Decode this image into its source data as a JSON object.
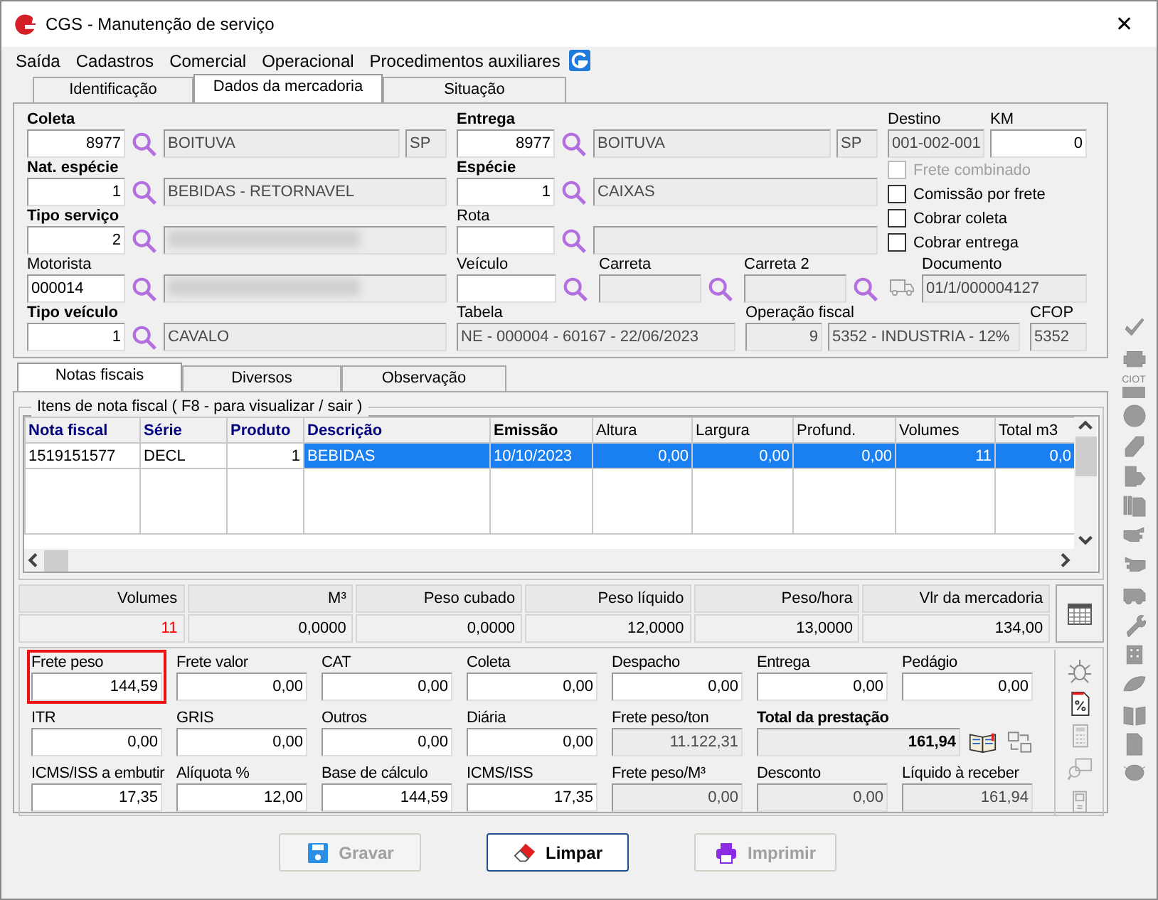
{
  "window": {
    "title": "CGS - Manutenção de serviço",
    "close": "✕"
  },
  "menu": [
    "Saída",
    "Cadastros",
    "Comercial",
    "Operacional",
    "Procedimentos auxiliares"
  ],
  "tabs": [
    {
      "label": "Identificação",
      "selected": false
    },
    {
      "label": "Dados da mercadoria",
      "selected": true
    },
    {
      "label": "Situação",
      "selected": false
    }
  ],
  "form": {
    "lines": [
      {
        "groups": [
          {
            "label": "Coleta",
            "bold": true,
            "lookup": true,
            "fields": [
              {
                "kind": "code",
                "value": "8977",
                "disabled": false
              },
              {
                "kind": "text",
                "value": "BOITUVA",
                "disabled": true
              },
              {
                "kind": "uf",
                "value": "SP",
                "disabled": true
              }
            ]
          },
          {
            "label": "Entrega",
            "bold": true,
            "lookup": true,
            "fields": [
              {
                "kind": "code",
                "value": "8977",
                "disabled": false
              },
              {
                "kind": "text",
                "value": "BOITUVA",
                "disabled": true
              },
              {
                "kind": "uf",
                "value": "SP",
                "disabled": true
              }
            ]
          }
        ]
      },
      {
        "groups": [
          {
            "label": "Nat. espécie",
            "bold": true,
            "lookup": true,
            "fields": [
              {
                "kind": "code",
                "value": "1",
                "disabled": false
              },
              {
                "kind": "text",
                "value": "BEBIDAS - RETORNAVEL",
                "disabled": true
              }
            ]
          },
          {
            "label": "Espécie",
            "bold": true,
            "lookup": true,
            "fields": [
              {
                "kind": "code",
                "value": "1",
                "disabled": false
              },
              {
                "kind": "text",
                "value": "CAIXAS",
                "disabled": true
              }
            ]
          }
        ]
      },
      {
        "groups": [
          {
            "label": "Tipo serviço",
            "bold": true,
            "lookup": true,
            "fields": [
              {
                "kind": "code",
                "value": "2",
                "disabled": false
              },
              {
                "kind": "text",
                "redacted": true,
                "disabled": true
              }
            ]
          },
          {
            "label": "Rota",
            "bold": false,
            "lookup": true,
            "fields": [
              {
                "kind": "code",
                "disabled": false
              },
              {
                "kind": "text",
                "disabled": true
              }
            ]
          }
        ]
      },
      {
        "groups": [
          {
            "label": "Motorista",
            "bold": false,
            "lookup": true,
            "fields": [
              {
                "kind": "id",
                "value": "000014",
                "disabled": false
              },
              {
                "kind": "text",
                "redacted": true,
                "disabled": true
              }
            ]
          },
          {
            "label": "Veículo",
            "bold": false,
            "lookup": true,
            "fields": [
              {
                "kind": "text",
                "disabled": false
              }
            ]
          },
          {
            "label": "Carreta",
            "bold": false,
            "lookup": true,
            "fields": [
              {
                "kind": "text",
                "disabled": true
              }
            ]
          },
          {
            "label": "Carreta 2",
            "bold": false,
            "lookup": true,
            "fields": [
              {
                "kind": "text",
                "disabled": true
              }
            ]
          },
          {
            "label": "Documento",
            "bold": false,
            "lookup": false,
            "fields": [
              {
                "kind": "text",
                "value": "01/1/000004127",
                "disabled": true
              }
            ]
          }
        ]
      },
      {
        "groups": [
          {
            "label": "Tipo veículo",
            "bold": true,
            "lookup": true,
            "fields": [
              {
                "kind": "code",
                "value": "1",
                "disabled": false
              },
              {
                "kind": "text",
                "value": "CAVALO",
                "disabled": true
              }
            ]
          },
          {
            "label": "Tabela",
            "bold": false,
            "lookup": false,
            "fields": [
              {
                "kind": "text",
                "value": "NE - 000004 - 60167 - 22/06/2023",
                "disabled": true
              }
            ]
          },
          {
            "label": "Operação fiscal",
            "bold": false,
            "lookup": false,
            "fields": [
              {
                "kind": "num",
                "value": "9",
                "disabled": true
              },
              {
                "kind": "text",
                "value": "5352 - INDUSTRIA - 12%",
                "disabled": true
              }
            ]
          },
          {
            "label": "CFOP",
            "bold": false,
            "lookup": false,
            "fields": [
              {
                "kind": "text",
                "value": "5352",
                "disabled": true
              }
            ]
          }
        ]
      }
    ],
    "side": [
      {
        "label": "Destino",
        "fields": [
          {
            "kind": "text",
            "value": "001-002-001",
            "disabled": true
          }
        ]
      },
      {
        "label": "KM",
        "fields": [
          {
            "kind": "code",
            "value": "0",
            "disabled": false
          }
        ]
      }
    ],
    "checks": [
      {
        "label": "Frete combinado",
        "checked": false,
        "disabled": true
      },
      {
        "label": "Comissão por frete",
        "checked": false,
        "disabled": false
      },
      {
        "label": "Cobrar coleta",
        "checked": false,
        "disabled": false
      },
      {
        "label": "Cobrar entrega",
        "checked": false,
        "disabled": false
      }
    ]
  },
  "toolbar": {
    "ciot": "CIOT"
  },
  "inner_tabs": [
    {
      "label": "Notas fiscais",
      "selected": true
    },
    {
      "label": "Diversos",
      "selected": false
    },
    {
      "label": "Observação",
      "selected": false
    }
  ],
  "items": {
    "title": "Itens de nota fiscal ( F8 - para visualizar / sair )",
    "columns": [
      {
        "label": "Nota fiscal",
        "kind": "key",
        "fixed": true
      },
      {
        "label": "Série",
        "kind": "key",
        "fixed": true
      },
      {
        "label": "Produto",
        "kind": "key",
        "fixed": true
      },
      {
        "label": "Descrição",
        "kind": "key",
        "fixed": false
      },
      {
        "label": "Emissão",
        "kind": "bold",
        "fixed": false
      },
      {
        "label": "Altura",
        "kind": "plain",
        "fixed": false
      },
      {
        "label": "Largura",
        "kind": "plain",
        "fixed": false
      },
      {
        "label": "Profund.",
        "kind": "plain",
        "fixed": false
      },
      {
        "label": "Volumes",
        "kind": "plain",
        "fixed": false
      },
      {
        "label": "Total m3",
        "kind": "plain",
        "fixed": false
      }
    ],
    "rows": [
      {
        "selected": true,
        "cells": [
          "1519151577",
          "DECL",
          "1",
          "BEBIDAS",
          "10/10/2023",
          "0,00",
          "0,00",
          "0,00",
          "11",
          "0,0"
        ]
      }
    ]
  },
  "summary": [
    {
      "label": "Volumes",
      "value": "11",
      "color": "#ff0000"
    },
    {
      "label": "M³",
      "value": "0,0000",
      "color": "#000000"
    },
    {
      "label": "Peso cubado",
      "value": "0,0000",
      "color": "#000000"
    },
    {
      "label": "Peso líquido",
      "value": "12,0000",
      "color": "#000000"
    },
    {
      "label": "Peso/hora",
      "value": "13,0000",
      "color": "#000000"
    },
    {
      "label": "Vlr da mercadoria",
      "value": "134,00",
      "color": "#000000"
    }
  ],
  "charges": [
    {
      "items": [
        {
          "kind": "field",
          "label": "Frete peso",
          "value": "144,59",
          "disabled": false,
          "highlighted": true
        },
        {
          "kind": "field",
          "label": "Frete valor",
          "value": "0,00",
          "disabled": false,
          "highlighted": false
        },
        {
          "kind": "field",
          "label": "CAT",
          "value": "0,00",
          "disabled": false,
          "highlighted": false
        },
        {
          "kind": "field",
          "label": "Coleta",
          "value": "0,00",
          "disabled": false,
          "highlighted": false
        },
        {
          "kind": "field",
          "label": "Despacho",
          "value": "0,00",
          "disabled": false,
          "highlighted": false
        },
        {
          "kind": "field",
          "label": "Entrega",
          "value": "0,00",
          "disabled": false,
          "highlighted": false
        },
        {
          "kind": "field",
          "label": "Pedágio",
          "value": "0,00",
          "disabled": false,
          "highlighted": false
        }
      ]
    },
    {
      "items": [
        {
          "kind": "field",
          "label": "ITR",
          "value": "0,00",
          "disabled": false,
          "highlighted": false
        },
        {
          "kind": "field",
          "label": "GRIS",
          "value": "0,00",
          "disabled": false,
          "highlighted": false
        },
        {
          "kind": "field",
          "label": "Outros",
          "value": "0,00",
          "disabled": false,
          "highlighted": false
        },
        {
          "kind": "field",
          "label": "Diária",
          "value": "0,00",
          "disabled": false,
          "highlighted": false
        },
        {
          "kind": "field",
          "label": "Frete peso/ton",
          "value": "11.122,31",
          "disabled": true,
          "highlighted": false
        },
        {
          "kind": "total",
          "label": "Total da prestação",
          "value": "161,94",
          "disabled": true,
          "highlighted": false
        }
      ]
    },
    {
      "items": [
        {
          "kind": "field",
          "label": "ICMS/ISS a embutir",
          "value": "17,35",
          "disabled": false,
          "highlighted": false
        },
        {
          "kind": "field",
          "label": "Alíquota %",
          "value": "12,00",
          "disabled": false,
          "highlighted": false
        },
        {
          "kind": "field",
          "label": "Base de cálculo",
          "value": "144,59",
          "disabled": false,
          "highlighted": false
        },
        {
          "kind": "field",
          "label": "ICMS/ISS",
          "value": "17,35",
          "disabled": false,
          "highlighted": false
        },
        {
          "kind": "field",
          "label": "Frete peso/M³",
          "value": "0,00",
          "disabled": true,
          "highlighted": false
        },
        {
          "kind": "field",
          "label": "Desconto",
          "value": "0,00",
          "disabled": true,
          "highlighted": false
        },
        {
          "kind": "field",
          "label": "Líquido à receber",
          "value": "161,94",
          "disabled": true,
          "highlighted": false
        }
      ]
    }
  ],
  "buttons": [
    {
      "label": "Gravar",
      "disabled": true
    },
    {
      "label": "Limpar",
      "disabled": false
    },
    {
      "label": "Imprimir",
      "disabled": true
    }
  ]
}
